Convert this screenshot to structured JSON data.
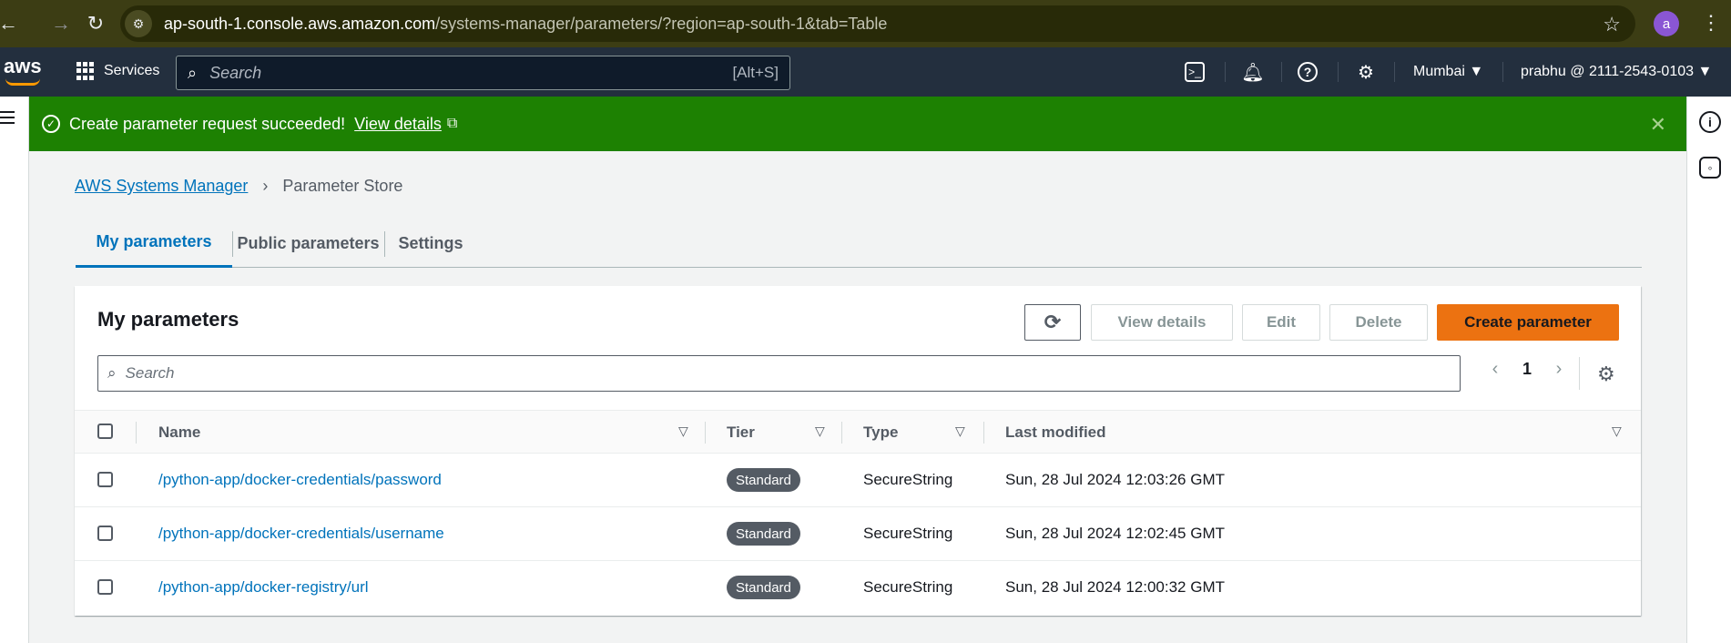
{
  "browser": {
    "url_host": "ap-south-1.console.aws.amazon.com",
    "url_path": "/systems-manager/parameters/?region=ap-south-1&tab=Table",
    "profile_initial": "a"
  },
  "nav": {
    "services_label": "Services",
    "search_placeholder": "Search",
    "search_shortcut": "[Alt+S]",
    "region": "Mumbai ▼",
    "account": "prabhu @ 2111-2543-0103 ▼"
  },
  "flash": {
    "message": "Create parameter request succeeded!",
    "link_label": "View details"
  },
  "breadcrumb": {
    "root": "AWS Systems Manager",
    "current": "Parameter Store"
  },
  "tabs": [
    "My parameters",
    "Public parameters",
    "Settings"
  ],
  "card": {
    "title": "My parameters",
    "buttons": {
      "view_details": "View details",
      "edit": "Edit",
      "delete": "Delete",
      "create": "Create parameter"
    },
    "search_placeholder": "Search",
    "page": "1"
  },
  "table": {
    "columns": [
      "Name",
      "Tier",
      "Type",
      "Last modified"
    ],
    "rows": [
      {
        "name": "/python-app/docker-credentials/password",
        "tier": "Standard",
        "type": "SecureString",
        "modified": "Sun, 28 Jul 2024 12:03:26 GMT"
      },
      {
        "name": "/python-app/docker-credentials/username",
        "tier": "Standard",
        "type": "SecureString",
        "modified": "Sun, 28 Jul 2024 12:02:45 GMT"
      },
      {
        "name": "/python-app/docker-registry/url",
        "tier": "Standard",
        "type": "SecureString",
        "modified": "Sun, 28 Jul 2024 12:00:32 GMT"
      }
    ]
  },
  "colors": {
    "flash_success": "#1d8102",
    "primary_button": "#ec7211",
    "link": "#0073bb",
    "nav_bg": "#232f3e"
  }
}
